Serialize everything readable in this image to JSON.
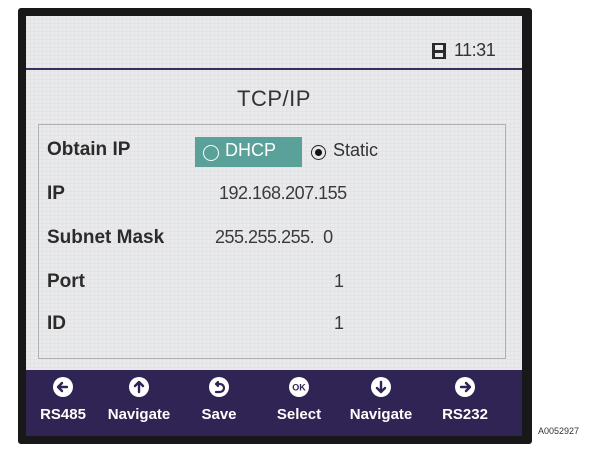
{
  "status": {
    "time": "11:31",
    "storage_icon": "sd-card-icon"
  },
  "title": "TCP/IP",
  "settings": {
    "obtain_ip": {
      "label": "Obtain IP",
      "options": [
        "DHCP",
        "Static"
      ],
      "selected": "Static",
      "highlighted": "DHCP"
    },
    "ip": {
      "label": "IP",
      "value": "192.168.207.155"
    },
    "subnet_mask": {
      "label": "Subnet Mask",
      "value": "255.255.255.  0"
    },
    "port": {
      "label": "Port",
      "value": "1"
    },
    "id": {
      "label": "ID",
      "value": "1"
    }
  },
  "softkeys": [
    {
      "label": "RS485",
      "icon": "arrow-left-circle-icon"
    },
    {
      "label": "Navigate",
      "icon": "arrow-up-circle-icon"
    },
    {
      "label": "Save",
      "icon": "undo-circle-icon"
    },
    {
      "label": "Select",
      "icon": "ok-circle-icon"
    },
    {
      "label": "Navigate",
      "icon": "arrow-down-circle-icon"
    },
    {
      "label": "RS232",
      "icon": "arrow-right-circle-icon"
    }
  ],
  "figure_code": "A0052927",
  "colors": {
    "footer": "#2f2453",
    "highlight": "#5aa19a",
    "screen": "#e9eaeb"
  }
}
